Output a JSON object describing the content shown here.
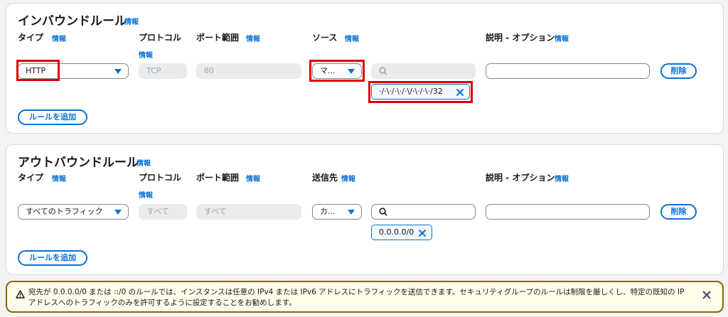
{
  "inbound": {
    "title": "インバウンドルール",
    "title_info": "情報",
    "headers": {
      "type": "タイプ",
      "type_info": "情報",
      "protocol": "プロトコル",
      "protocol_info": "情報",
      "port_range": "ポート範囲",
      "port_info": "情報",
      "source": "ソース",
      "source_info": "情報",
      "description": "説明 - オプション",
      "description_info": "情報"
    },
    "row": {
      "type_value": "HTTP",
      "protocol_value": "TCP",
      "port_value": "80",
      "source_value": "マ...",
      "search_value": "",
      "description_value": "",
      "token_value": "·/·\\·/·\\·/·\\/·\\·/·\\·/32",
      "delete_label": "削除"
    },
    "add_rule_label": "ルールを追加"
  },
  "outbound": {
    "title": "アウトバウンドルール",
    "title_info": "情報",
    "headers": {
      "type": "タイプ",
      "type_info": "情報",
      "protocol": "プロトコル",
      "protocol_info": "情報",
      "port_range": "ポート範囲",
      "port_info": "情報",
      "destination": "送信先",
      "destination_info": "情報",
      "description": "説明 - オプション",
      "description_info": "情報"
    },
    "row": {
      "type_value": "すべてのトラフィック",
      "protocol_value": "すべて",
      "port_value": "すべて",
      "destination_value": "カ...",
      "search_value": "",
      "description_value": "",
      "token_value": "0.0.0.0/0",
      "delete_label": "削除"
    },
    "add_rule_label": "ルールを追加"
  },
  "warning": {
    "text": "宛先が 0.0.0.0/0 または ::/0 のルールでは、インスタンスは任意の IPv4 または IPv6 アドレスにトラフィックを送信できます。セキュリティグループのルールは制限を厳しくし、特定の既知の IP アドレスへのトラフィックのみを許可するように設定することをお勧めします。"
  },
  "icons": {
    "search": "search-icon",
    "caret": "caret-down-icon",
    "remove": "close-icon",
    "warning": "warning-triangle-icon",
    "dismiss": "close-icon"
  },
  "colors": {
    "accent": "#0972d3",
    "highlight": "#e00000",
    "warning_border": "#8d6605",
    "warning_bg": "#fffce9"
  }
}
